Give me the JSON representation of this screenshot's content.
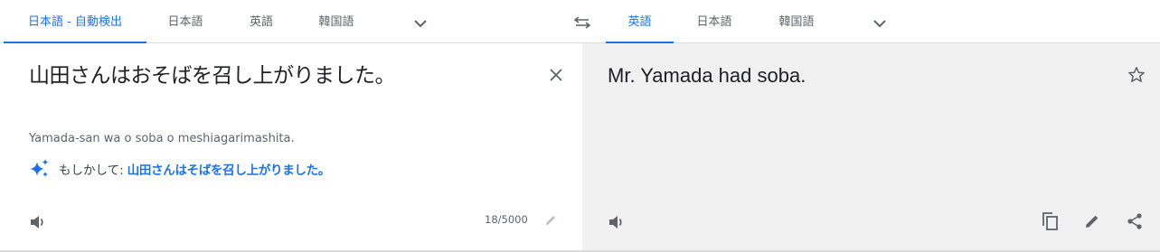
{
  "source_languages": {
    "tabs": [
      {
        "label": "日本語 - 自動検出",
        "active": true
      },
      {
        "label": "日本語",
        "active": false
      },
      {
        "label": "英語",
        "active": false
      },
      {
        "label": "韓国語",
        "active": false
      }
    ]
  },
  "target_languages": {
    "tabs": [
      {
        "label": "英語",
        "active": true
      },
      {
        "label": "日本語",
        "active": false
      },
      {
        "label": "韓国語",
        "active": false
      }
    ]
  },
  "source": {
    "text": "山田さんはおそばを召し上がりました。",
    "transliteration": "Yamada-san wa o soba o meshiagarimashita.",
    "suggestion_prefix": "もしかして:",
    "suggestion_text": "山田さんはそばを召し上がりました。",
    "char_count": "18/5000"
  },
  "target": {
    "text": "Mr. Yamada had soba."
  },
  "icons": {
    "more_languages": "chevron-down-icon",
    "swap": "swap-arrows-icon",
    "clear": "close-icon",
    "sparkle": "sparkle-icon",
    "listen": "speaker-icon",
    "edit": "pencil-icon",
    "save": "star-icon",
    "copy": "copy-icon",
    "share": "share-icon"
  },
  "colors": {
    "accent": "#1a73e8",
    "target_background": "#f1f1f1",
    "muted_text": "#5f6368"
  }
}
